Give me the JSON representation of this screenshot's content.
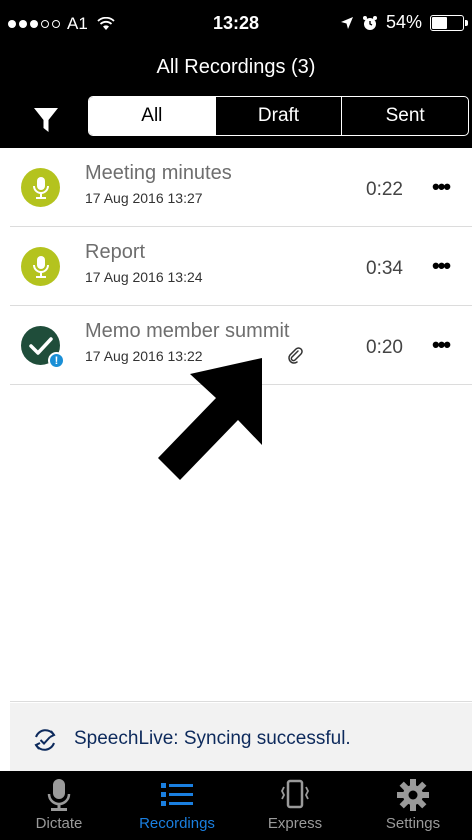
{
  "status_bar": {
    "carrier": "A1",
    "time": "13:28",
    "battery": "54%",
    "battery_level": 0.54,
    "signal_bars": 3
  },
  "header": {
    "title": "All Recordings (3)",
    "segments": [
      "All",
      "Draft",
      "Sent"
    ],
    "selected_segment": "All"
  },
  "recordings": [
    {
      "title": "Meeting minutes",
      "date": "17 Aug 2016 13:27",
      "duration": "0:22",
      "status": "draft",
      "icon": "microphone-icon"
    },
    {
      "title": "Report",
      "date": "17 Aug 2016 13:24",
      "duration": "0:34",
      "status": "draft",
      "icon": "microphone-icon"
    },
    {
      "title": "Memo member summit",
      "date": "17 Aug 2016 13:22",
      "duration": "0:20",
      "status": "sent",
      "icon": "checkmark-icon",
      "has_attachment": true,
      "badge": "!"
    }
  ],
  "more_label": "•••",
  "sync_banner": {
    "text": "SpeechLive: Syncing successful."
  },
  "tabs": [
    {
      "label": "Dictate",
      "icon": "microphone-icon",
      "active": false
    },
    {
      "label": "Recordings",
      "icon": "list-icon",
      "active": true
    },
    {
      "label": "Express",
      "icon": "vibrating-phone-icon",
      "active": false
    },
    {
      "label": "Settings",
      "icon": "gear-icon",
      "active": false
    }
  ],
  "colors": {
    "draft_avatar": "#b4c31e",
    "sent_avatar": "#1f4d3a",
    "badge": "#1a8fd6",
    "active_tab": "#1a7fe0",
    "sync_text": "#0d2a5c"
  }
}
